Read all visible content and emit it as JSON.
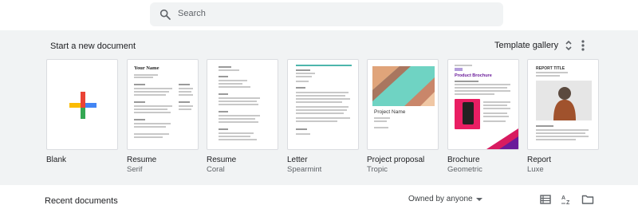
{
  "search": {
    "placeholder": "Search"
  },
  "gallery": {
    "title": "Start a new document",
    "template_gallery_label": "Template gallery",
    "templates": [
      {
        "name": "Blank",
        "subtitle": ""
      },
      {
        "name": "Resume",
        "subtitle": "Serif",
        "thumb_text": "Your Name"
      },
      {
        "name": "Resume",
        "subtitle": "Coral"
      },
      {
        "name": "Letter",
        "subtitle": "Spearmint"
      },
      {
        "name": "Project proposal",
        "subtitle": "Tropic",
        "thumb_text": "Project Name"
      },
      {
        "name": "Brochure",
        "subtitle": "Geometric",
        "thumb_text": "Product Brochure"
      },
      {
        "name": "Report",
        "subtitle": "Luxe",
        "thumb_text": "REPORT TITLE"
      }
    ]
  },
  "recent": {
    "title": "Recent documents",
    "owned_by": "Owned by anyone"
  },
  "colors": {
    "plus_red": "#ea4335",
    "plus_blue": "#4285f4",
    "plus_green": "#34a853",
    "plus_yellow": "#fbbc04",
    "spearmint": "#4db6ac",
    "tropic_teal": "#6fd3c3",
    "tropic_orange": "#e0a47a",
    "brochure_pink": "#d81b60",
    "brochure_purple": "#6a1b9a"
  }
}
